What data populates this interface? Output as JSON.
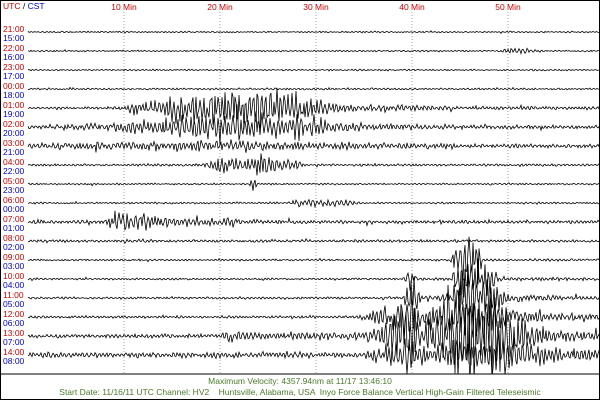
{
  "header": {
    "utc_label": "UTC",
    "separator": " / ",
    "cst_label": "CST"
  },
  "chart_data": {
    "type": "line",
    "xlim": [
      0,
      60
    ],
    "x_tick_values": [
      10,
      20,
      30,
      40,
      50
    ],
    "x_ticks": [
      "10 Min",
      "20 Min",
      "30 Min",
      "40 Min",
      "50 Min"
    ],
    "grid": true,
    "colors": {
      "utc": "#cc0000",
      "cst": "#0000cc",
      "trace": "#000000",
      "grid": "#7a7a7a",
      "footer": "#4a7a2a"
    },
    "rows": [
      {
        "utc": "21:00",
        "cst": "15:00",
        "relative_amplitude": [
          [
            0,
            0.012
          ],
          [
            60,
            0.012
          ]
        ]
      },
      {
        "utc": "22:00",
        "cst": "16:00",
        "relative_amplitude": [
          [
            0,
            0.012
          ],
          [
            49,
            0.012
          ],
          [
            50,
            0.045
          ],
          [
            52,
            0.04
          ],
          [
            54,
            0.012
          ],
          [
            60,
            0.012
          ]
        ]
      },
      {
        "utc": "23:00",
        "cst": "17:00",
        "relative_amplitude": [
          [
            0,
            0.012
          ],
          [
            60,
            0.012
          ]
        ]
      },
      {
        "utc": "00:00",
        "cst": "18:00",
        "relative_amplitude": [
          [
            0,
            0.014
          ],
          [
            60,
            0.014
          ]
        ]
      },
      {
        "utc": "01:00",
        "cst": "19:00",
        "relative_amplitude": [
          [
            0,
            0.016
          ],
          [
            9,
            0.02
          ],
          [
            13,
            0.12
          ],
          [
            16,
            0.3
          ],
          [
            24,
            0.38
          ],
          [
            28,
            0.2
          ],
          [
            33,
            0.06
          ],
          [
            45,
            0.03
          ],
          [
            60,
            0.025
          ]
        ]
      },
      {
        "utc": "02:00",
        "cst": "20:00",
        "relative_amplitude": [
          [
            0,
            0.03
          ],
          [
            9,
            0.06
          ],
          [
            13,
            0.14
          ],
          [
            20,
            0.24
          ],
          [
            28,
            0.18
          ],
          [
            33,
            0.07
          ],
          [
            40,
            0.04
          ],
          [
            60,
            0.03
          ]
        ]
      },
      {
        "utc": "03:00",
        "cst": "21:00",
        "relative_amplitude": [
          [
            0,
            0.045
          ],
          [
            12,
            0.07
          ],
          [
            20,
            0.09
          ],
          [
            30,
            0.06
          ],
          [
            45,
            0.035
          ],
          [
            60,
            0.028
          ]
        ]
      },
      {
        "utc": "04:00",
        "cst": "22:00",
        "relative_amplitude": [
          [
            0,
            0.018
          ],
          [
            18,
            0.02
          ],
          [
            20,
            0.14
          ],
          [
            24,
            0.18
          ],
          [
            27,
            0.09
          ],
          [
            29,
            0.02
          ],
          [
            60,
            0.018
          ]
        ]
      },
      {
        "utc": "05:00",
        "cst": "23:00",
        "relative_amplitude": [
          [
            0,
            0.014
          ],
          [
            23,
            0.014
          ],
          [
            23.5,
            0.14
          ],
          [
            24,
            0.014
          ],
          [
            60,
            0.014
          ]
        ]
      },
      {
        "utc": "06:00",
        "cst": "00:00",
        "relative_amplitude": [
          [
            0,
            0.014
          ],
          [
            27,
            0.014
          ],
          [
            28,
            0.06
          ],
          [
            33,
            0.05
          ],
          [
            35,
            0.014
          ],
          [
            60,
            0.014
          ]
        ]
      },
      {
        "utc": "07:00",
        "cst": "01:00",
        "relative_amplitude": [
          [
            0,
            0.03
          ],
          [
            8,
            0.03
          ],
          [
            9,
            0.17
          ],
          [
            12,
            0.17
          ],
          [
            15,
            0.07
          ],
          [
            22,
            0.06
          ],
          [
            25,
            0.03
          ],
          [
            60,
            0.025
          ]
        ]
      },
      {
        "utc": "08:00",
        "cst": "02:00",
        "relative_amplitude": [
          [
            0,
            0.025
          ],
          [
            60,
            0.02
          ]
        ]
      },
      {
        "utc": "09:00",
        "cst": "03:00",
        "relative_amplitude": [
          [
            0,
            0.015
          ],
          [
            44,
            0.015
          ],
          [
            45,
            0.5
          ],
          [
            46.5,
            0.4
          ],
          [
            47.5,
            0.02
          ],
          [
            60,
            0.02
          ]
        ]
      },
      {
        "utc": "10:00",
        "cst": "04:00",
        "relative_amplitude": [
          [
            0,
            0.015
          ],
          [
            39,
            0.015
          ],
          [
            40,
            0.2
          ],
          [
            40.6,
            0.02
          ],
          [
            44,
            0.03
          ],
          [
            45,
            0.35
          ],
          [
            48,
            0.28
          ],
          [
            49,
            0.03
          ],
          [
            60,
            0.025
          ]
        ]
      },
      {
        "utc": "11:00",
        "cst": "05:00",
        "relative_amplitude": [
          [
            0,
            0.015
          ],
          [
            39,
            0.02
          ],
          [
            40,
            0.45
          ],
          [
            41,
            0.05
          ],
          [
            44,
            0.07
          ],
          [
            45,
            0.4
          ],
          [
            48,
            0.35
          ],
          [
            50,
            0.06
          ],
          [
            60,
            0.03
          ]
        ]
      },
      {
        "utc": "12:00",
        "cst": "06:00",
        "relative_amplitude": [
          [
            0,
            0.02
          ],
          [
            34,
            0.02
          ],
          [
            35,
            0.06
          ],
          [
            40,
            0.4
          ],
          [
            41,
            0.09
          ],
          [
            45,
            0.45
          ],
          [
            49,
            0.38
          ],
          [
            51,
            0.09
          ],
          [
            60,
            0.05
          ]
        ]
      },
      {
        "utc": "13:00",
        "cst": "07:00",
        "relative_amplitude": [
          [
            0,
            0.03
          ],
          [
            20,
            0.03
          ],
          [
            21,
            0.1
          ],
          [
            25,
            0.06
          ],
          [
            35,
            0.07
          ],
          [
            36,
            0.14
          ],
          [
            40,
            0.5
          ],
          [
            41,
            0.16
          ],
          [
            45,
            0.7
          ],
          [
            46.2,
            1.0
          ],
          [
            49,
            0.6
          ],
          [
            52,
            0.2
          ],
          [
            56,
            0.1
          ],
          [
            60,
            0.08
          ]
        ]
      },
      {
        "utc": "14:00",
        "cst": "08:00",
        "relative_amplitude": [
          [
            0,
            0.045
          ],
          [
            35,
            0.045
          ],
          [
            36,
            0.11
          ],
          [
            40,
            0.3
          ],
          [
            42,
            0.12
          ],
          [
            45,
            0.35
          ],
          [
            50,
            0.3
          ],
          [
            55,
            0.12
          ],
          [
            60,
            0.07
          ]
        ]
      }
    ]
  },
  "footer": {
    "max_velocity": "Maximum Velocity: 4357.94nm at 11/17 13:46:10",
    "station_info": "Start Date: 11/16/11 UTC Channel: HV2    Huntsville, Alabama, USA  Inyo Force Balance Vertical High-Gain Filtered Teleseismic"
  }
}
